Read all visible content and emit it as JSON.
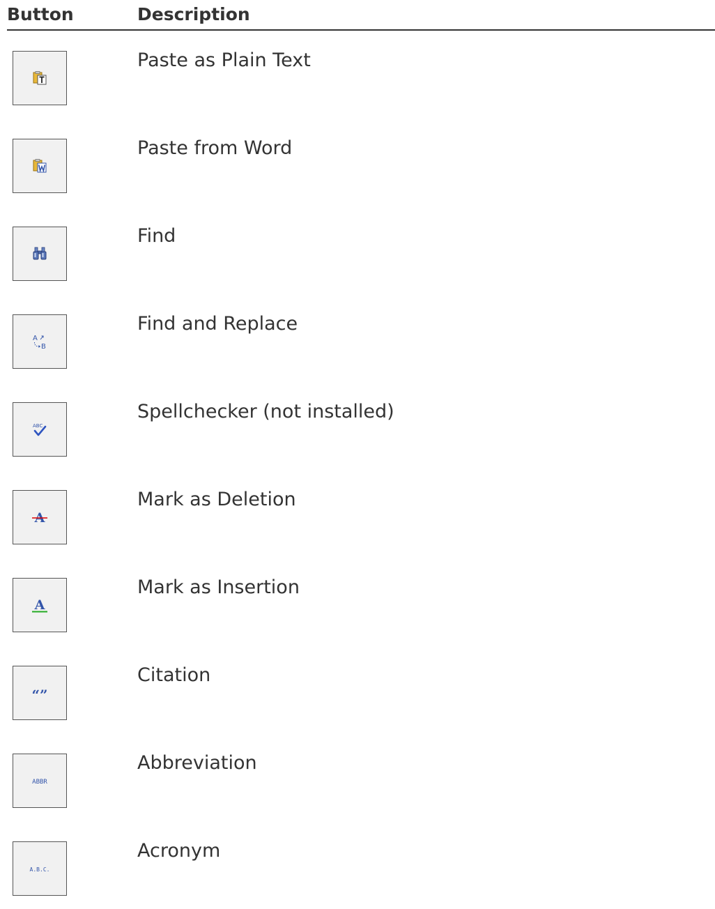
{
  "table": {
    "headers": {
      "button": "Button",
      "description": "Description"
    },
    "rows": [
      {
        "icon": "paste-plain-text-icon",
        "description": "Paste as Plain Text"
      },
      {
        "icon": "paste-from-word-icon",
        "description": "Paste from Word"
      },
      {
        "icon": "binoculars-find-icon",
        "description": "Find"
      },
      {
        "icon": "find-replace-icon",
        "description": "Find and Replace"
      },
      {
        "icon": "spellcheck-icon",
        "description": "Spellchecker (not installed)"
      },
      {
        "icon": "strikethrough-a-icon",
        "description": "Mark as Deletion"
      },
      {
        "icon": "underlined-a-icon",
        "description": "Mark as Insertion"
      },
      {
        "icon": "quotation-marks-icon",
        "description": "Citation"
      },
      {
        "icon": "abbr-icon",
        "description": "Abbreviation"
      },
      {
        "icon": "acronym-icon",
        "description": "Acronym"
      }
    ],
    "icon_glyphs": {
      "find_replace_a": "A",
      "find_replace_b": "B",
      "spellcheck": "ABC",
      "letter_a": "A",
      "quote": "“”",
      "abbr": "ABBR",
      "acronym": "A.B.C."
    }
  },
  "colors": {
    "text": "#333333",
    "rule": "#333333",
    "button_border": "#555555",
    "button_bg": "#f1f1f1",
    "icon_blue": "#3355aa",
    "deletion_red": "#dd0000",
    "insertion_green": "#22aa22",
    "clipboard_gold": "#d9a520"
  }
}
